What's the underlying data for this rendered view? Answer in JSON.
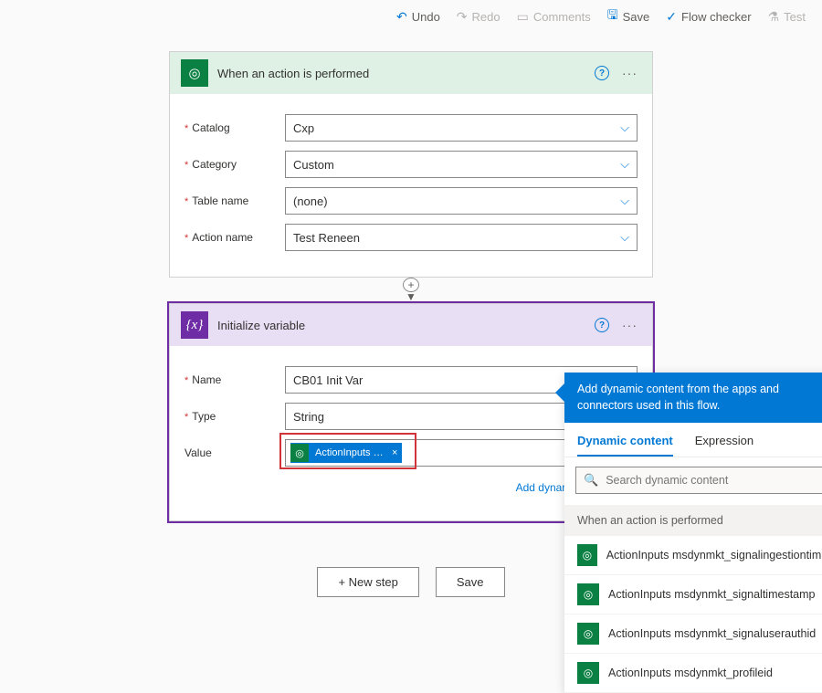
{
  "toolbar": {
    "undo": "Undo",
    "redo": "Redo",
    "comments": "Comments",
    "save": "Save",
    "flow_checker": "Flow checker",
    "test": "Test"
  },
  "card1": {
    "title": "When an action is performed",
    "fields": {
      "catalog_label": "Catalog",
      "catalog_value": "Cxp",
      "category_label": "Category",
      "category_value": "Custom",
      "table_label": "Table name",
      "table_value": "(none)",
      "action_label": "Action name",
      "action_value": "Test Reneen"
    }
  },
  "card2": {
    "title": "Initialize variable",
    "curly": "{x}",
    "fields": {
      "name_label": "Name",
      "name_value": "CB01 Init Var",
      "type_label": "Type",
      "type_value": "String",
      "value_label": "Value",
      "token_text": "ActionInputs m…"
    },
    "dynamic_link": "Add dynamic content"
  },
  "buttons": {
    "new_step": "+ New step",
    "save": "Save"
  },
  "panel": {
    "headline": "Add dynamic content from the apps and connectors used in this flow.",
    "tab_dynamic": "Dynamic content",
    "tab_expression": "Expression",
    "search_placeholder": "Search dynamic content",
    "group": "When an action is performed",
    "items": [
      "ActionInputs msdynmkt_signalingestiontimestamp",
      "ActionInputs msdynmkt_signaltimestamp",
      "ActionInputs msdynmkt_signaluserauthid",
      "ActionInputs msdynmkt_profileid"
    ]
  }
}
